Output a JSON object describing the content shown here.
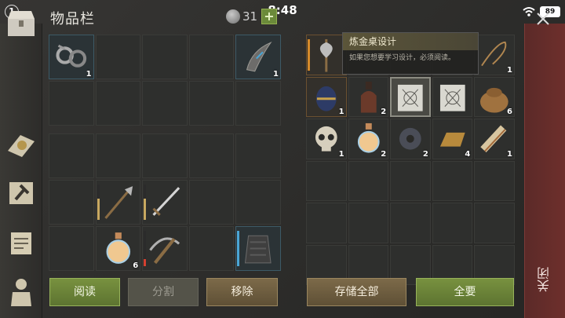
{
  "status": {
    "notifications": "1",
    "time": "8:48",
    "battery": "89"
  },
  "header": {
    "title": "物品栏",
    "coin_count": "31",
    "plus_label": "+"
  },
  "left_items": [
    {
      "name": "shackles-icon",
      "count": "1"
    },
    {
      "name": "boomerang-blade-icon",
      "count": "1"
    },
    {
      "name": "halberd-icon",
      "count": ""
    },
    {
      "name": "sword-icon",
      "count": ""
    },
    {
      "name": "potion-bottle-icon",
      "count": "6"
    },
    {
      "name": "crossbow-icon",
      "count": ""
    },
    {
      "name": "chainmail-armor-icon",
      "count": ""
    }
  ],
  "right_items": [
    {
      "name": "battle-axe-icon",
      "count": ""
    },
    {
      "name": "rope-icon",
      "count": "1"
    },
    {
      "name": "egg-icon",
      "count": "1"
    },
    {
      "name": "bottle-icon",
      "count": "2"
    },
    {
      "name": "blueprint-icon",
      "count": ""
    },
    {
      "name": "blueprint-icon",
      "count": ""
    },
    {
      "name": "sack-icon",
      "count": "6"
    },
    {
      "name": "skull-icon",
      "count": "1"
    },
    {
      "name": "potion-bottle-icon",
      "count": "2"
    },
    {
      "name": "gear-icon",
      "count": "2"
    },
    {
      "name": "ingot-icon",
      "count": "4"
    },
    {
      "name": "scroll-icon",
      "count": "1"
    }
  ],
  "tooltip": {
    "title": "炼金桌设计",
    "desc": "如果您想要学习设计，必须阅读。"
  },
  "buttons": {
    "read": "阅读",
    "split": "分割",
    "remove": "移除",
    "store_all": "存储全部",
    "all": "全要",
    "close": "关闭"
  },
  "colors": {
    "accent_green": "#78913f",
    "accent_brown": "#7c6a49",
    "close_red": "#6e2f2c",
    "rarity_blue": "#4aa6d6",
    "rarity_orange": "#d68a2a"
  }
}
